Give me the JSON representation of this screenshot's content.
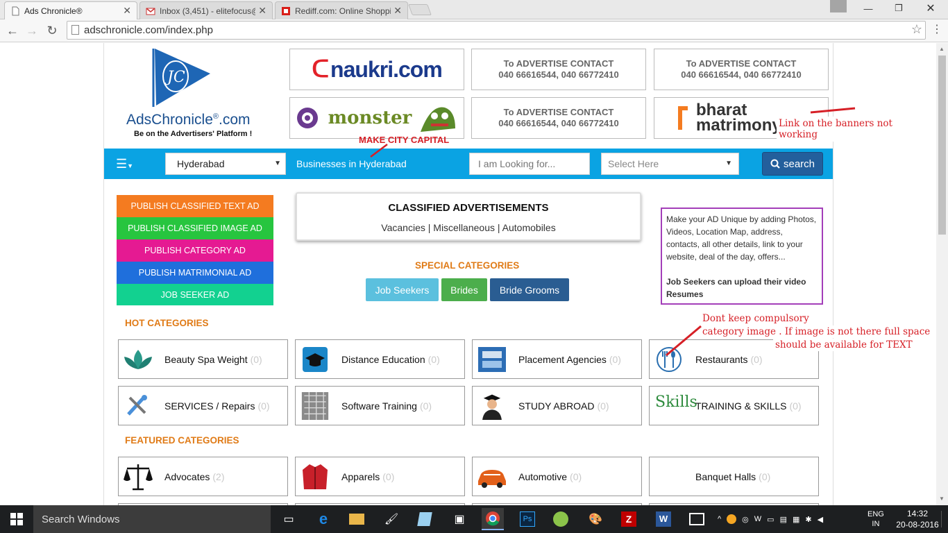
{
  "browser": {
    "tabs": [
      {
        "title": "Ads Chronicle®",
        "favicon": "page-icon",
        "active": true
      },
      {
        "title": "Inbox (3,451) - elitefocus@",
        "favicon": "gmail-icon",
        "active": false
      },
      {
        "title": "Rediff.com: Online Shoppi",
        "favicon": "rediff-icon",
        "active": false
      }
    ],
    "url": "adschronicle.com/index.php"
  },
  "site": {
    "logo": {
      "brand": "AdsChronicle",
      "reg": "®",
      "suffix": ".com",
      "tagline": "Be on the Advertisers' Platform !"
    },
    "banners": {
      "naukri": "naukri.com",
      "monster": "monster",
      "bharat_line1": "bharat",
      "bharat_line2": "matrimony",
      "contact_line1": "To ADVERTISE  CONTACT",
      "contact_line2": "040 66616544, 040 66772410"
    },
    "searchbar": {
      "city": "Hyderabad",
      "businesses_label": "Businesses in Hyderabad",
      "looking_placeholder": "I am Looking for...",
      "select_placeholder": "Select Here",
      "search_label": "search"
    },
    "publish_buttons": [
      {
        "label": "PUBLISH CLASSIFIED TEXT AD",
        "color": "#f47b20"
      },
      {
        "label": "PUBLISH CLASSIFIED IMAGE AD",
        "color": "#27c53f"
      },
      {
        "label": "PUBLISH CATEGORY AD",
        "color": "#e51a92"
      },
      {
        "label": "PUBLISH MATRIMONIAL AD",
        "color": "#1f6fdc"
      },
      {
        "label": "JOB SEEKER AD",
        "color": "#12d190"
      }
    ],
    "classified": {
      "title": "CLASSIFIED ADVERTISEMENTS",
      "links": [
        "Vacancies",
        "Miscellaneous",
        "Automobiles"
      ],
      "separator": " | "
    },
    "special": {
      "heading": "SPECIAL CATEGORIES",
      "buttons": [
        {
          "label": "Job Seekers",
          "color": "#5bc0de"
        },
        {
          "label": "Brides",
          "color": "#4cae4c"
        },
        {
          "label": "Bride Grooms",
          "color": "#2a5d92"
        }
      ]
    },
    "promo": {
      "text": "Make your AD Unique by adding Photos, Videos, Location Map, address, contacts, all other details, link to your website, deal of the day, offers...",
      "bold": "Job Seekers can upload their video Resumes"
    },
    "hot_heading": "HOT CATEGORIES",
    "hot": [
      {
        "name": "Beauty Spa Weight",
        "count": "(0)",
        "icon": "lotus-icon"
      },
      {
        "name": "Distance Education",
        "count": "(0)",
        "icon": "graduation-cap-icon"
      },
      {
        "name": "Placement Agencies",
        "count": "(0)",
        "icon": "placement-icon"
      },
      {
        "name": "Restaurants",
        "count": "(0)",
        "icon": "fork-spoon-icon"
      },
      {
        "name": "SERVICES / Repairs",
        "count": "(0)",
        "icon": "tools-icon"
      },
      {
        "name": "Software Training",
        "count": "(0)",
        "icon": "keyboard-icon"
      },
      {
        "name": "STUDY ABROAD",
        "count": "(0)",
        "icon": "graduate-icon"
      },
      {
        "name": "TRAINING & SKILLS",
        "count": "(0)",
        "icon": "skills-icon"
      }
    ],
    "featured_heading": "FEATURED CATEGORIES",
    "featured": [
      {
        "name": "Advocates",
        "count": "(2)",
        "icon": "scales-icon"
      },
      {
        "name": "Apparels",
        "count": "(0)",
        "icon": "jacket-icon"
      },
      {
        "name": "Automotive",
        "count": "(0)",
        "icon": "car-icon"
      },
      {
        "name": "Banquet Halls",
        "count": "(0)",
        "icon": ""
      }
    ],
    "skills_icon_text": "Skills"
  },
  "annotations": {
    "make_city_capital": "MAKE CITY CAPITAL",
    "banner_links": "Link on the banners not working",
    "image_line1": "Dont keep compulsory",
    "image_line2": "category image . If image is not there full space",
    "image_line3": "should be available for TEXT"
  },
  "taskbar": {
    "search_placeholder": "Search Windows",
    "lang1": "ENG",
    "lang2": "IN",
    "time": "14:32",
    "date": "20-08-2016"
  }
}
